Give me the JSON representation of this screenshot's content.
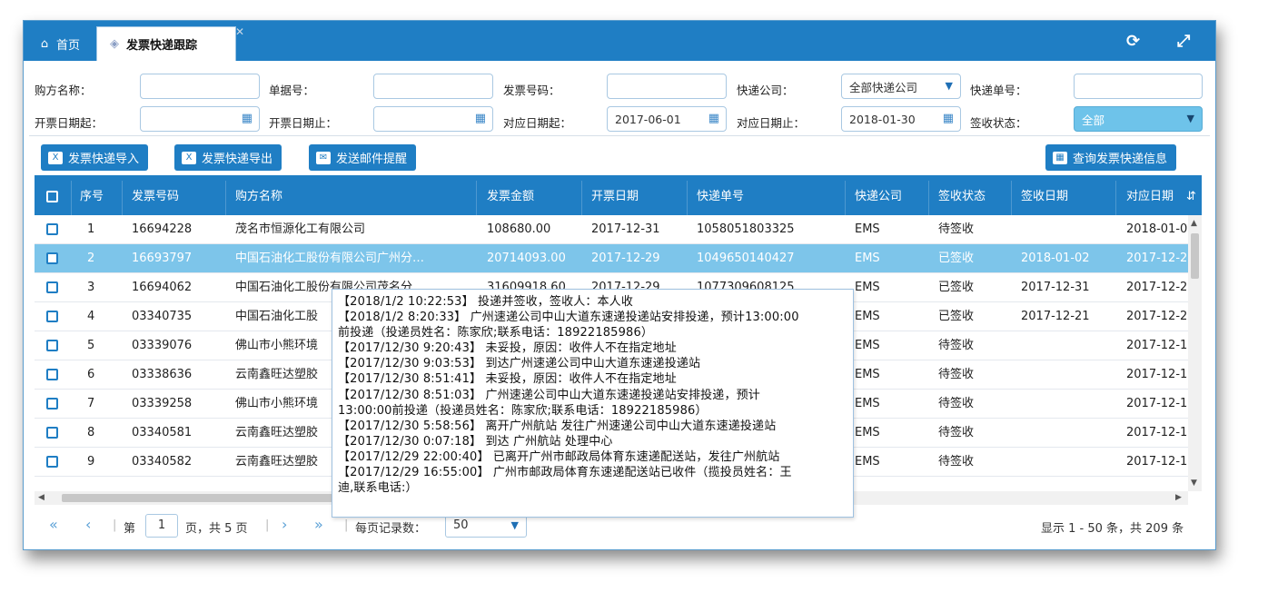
{
  "tabs": [
    {
      "label": "首页",
      "icon": "home-icon"
    },
    {
      "label": "发票快递跟踪",
      "icon": "tag-icon"
    }
  ],
  "window_controls": {
    "refresh_icon": "refresh-icon",
    "expand_icon": "expand-icon"
  },
  "filters": {
    "buyer_name": {
      "label": "购方名称：",
      "value": ""
    },
    "doc_no": {
      "label": "单据号：",
      "value": ""
    },
    "invoice_no": {
      "label": "发票号码：",
      "value": ""
    },
    "courier": {
      "label": "快递公司：",
      "value": "全部快递公司"
    },
    "tracking_no": {
      "label": "快递单号：",
      "value": ""
    },
    "issue_start": {
      "label": "开票日期起：",
      "value": ""
    },
    "issue_end": {
      "label": "开票日期止：",
      "value": ""
    },
    "match_start": {
      "label": "对应日期起：",
      "value": "2017-06-01"
    },
    "match_end": {
      "label": "对应日期止：",
      "value": "2018-01-30"
    },
    "sign_status": {
      "label": "签收状态：",
      "value": "全部"
    }
  },
  "toolbar": {
    "import_label": "发票快递导入",
    "export_label": "发票快递导出",
    "email_label": "发送邮件提醒",
    "query_label": "查询发票快递信息"
  },
  "columns": [
    "序号",
    "发票号码",
    "购方名称",
    "发票金额",
    "开票日期",
    "快递单号",
    "快递公司",
    "签收状态",
    "签收日期",
    "对应日期"
  ],
  "rows": [
    {
      "no": "1",
      "invoice": "16694228",
      "buyer": "茂名市恒源化工有限公司",
      "amount": "108680.00",
      "date": "2017-12-31",
      "tracking": "1058051803325",
      "company": "EMS",
      "status": "待签收",
      "sign_date": "",
      "match_date": "2018-01-0"
    },
    {
      "no": "2",
      "invoice": "16693797",
      "buyer": "中国石油化工股份有限公司广州分…",
      "amount": "20714093.00",
      "date": "2017-12-29",
      "tracking": "1049650140427",
      "company": "EMS",
      "status": "已签收",
      "sign_date": "2018-01-02",
      "match_date": "2017-12-2"
    },
    {
      "no": "3",
      "invoice": "16694062",
      "buyer": "中国石油化工股份有限公司茂名分",
      "amount": "31609918.60",
      "date": "2017-12-29",
      "tracking": "1077309608125",
      "company": "EMS",
      "status": "已签收",
      "sign_date": "2017-12-31",
      "match_date": "2017-12-2"
    },
    {
      "no": "4",
      "invoice": "03340735",
      "buyer": "中国石油化工股",
      "amount": "",
      "date": "",
      "tracking": "",
      "company": "EMS",
      "status": "已签收",
      "sign_date": "2017-12-21",
      "match_date": "2017-12-2"
    },
    {
      "no": "5",
      "invoice": "03339076",
      "buyer": "佛山市小熊环境",
      "amount": "",
      "date": "",
      "tracking": "",
      "company": "EMS",
      "status": "待签收",
      "sign_date": "",
      "match_date": "2017-12-1"
    },
    {
      "no": "6",
      "invoice": "03338636",
      "buyer": "云南鑫旺达塑胶",
      "amount": "",
      "date": "",
      "tracking": "",
      "company": "EMS",
      "status": "待签收",
      "sign_date": "",
      "match_date": "2017-12-1"
    },
    {
      "no": "7",
      "invoice": "03339258",
      "buyer": "佛山市小熊环境",
      "amount": "",
      "date": "",
      "tracking": "",
      "company": "EMS",
      "status": "待签收",
      "sign_date": "",
      "match_date": "2017-12-1"
    },
    {
      "no": "8",
      "invoice": "03340581",
      "buyer": "云南鑫旺达塑胶",
      "amount": "",
      "date": "",
      "tracking": "",
      "company": "EMS",
      "status": "待签收",
      "sign_date": "",
      "match_date": "2017-12-1"
    },
    {
      "no": "9",
      "invoice": "03340582",
      "buyer": "云南鑫旺达塑胶",
      "amount": "",
      "date": "",
      "tracking": "",
      "company": "EMS",
      "status": "待签收",
      "sign_date": "",
      "match_date": "2017-12-1"
    }
  ],
  "tooltip": {
    "lines": [
      "【2018/1/2 10:22:53】 投递并签收，签收人：本人收",
      "【2018/1/2 8:20:33】 广州速递公司中山大道东速递投递站安排投递，预计13:00:00",
      "前投递（投递员姓名：陈家欣;联系电话：18922185986）",
      "【2017/12/30 9:20:43】 未妥投，原因：收件人不在指定地址",
      "【2017/12/30 9:03:53】 到达广州速递公司中山大道东速递投递站",
      "【2017/12/30 8:51:41】 未妥投，原因：收件人不在指定地址",
      "【2017/12/30 8:51:03】 广州速递公司中山大道东速递投递站安排投递，预计",
      "13:00:00前投递（投递员姓名：陈家欣;联系电话：18922185986）",
      "【2017/12/30 5:58:56】 离开广州航站 发往广州速递公司中山大道东速递投递站",
      "【2017/12/30 0:07:18】 到达 广州航站 处理中心",
      "【2017/12/29 22:00:40】 已离开广州市邮政局体育东速递配送站，发往广州航站",
      "【2017/12/29 16:55:00】 广州市邮政局体育东速递配送站已收件（揽投员姓名：王",
      "迪,联系电话:）"
    ]
  },
  "pager": {
    "page_prefix": "第",
    "page": "1",
    "page_suffix": "页，共 5 页",
    "per_page_label": "每页记录数：",
    "per_page": "50",
    "summary": "显示 1 - 50 条，共 209 条"
  }
}
